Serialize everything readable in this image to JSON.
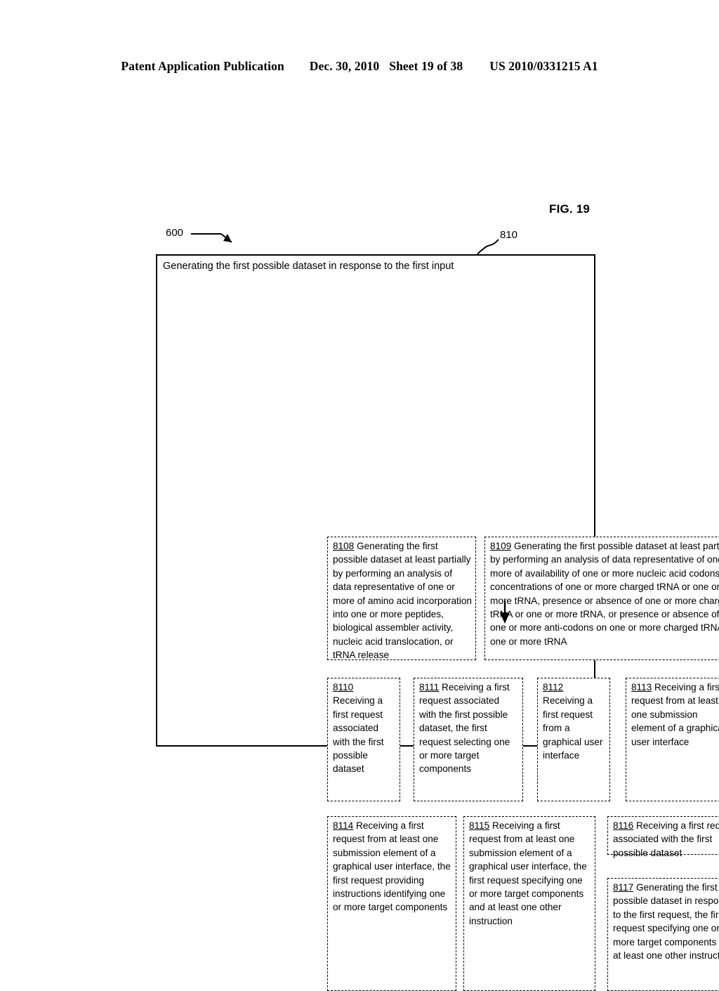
{
  "header": {
    "publication": "Patent Application Publication",
    "date": "Dec. 30, 2010",
    "sheet": "Sheet 19 of 38",
    "patent_number": "US 2010/0331215 A1"
  },
  "figure": {
    "label": "FIG. 19",
    "ref_outer": "600",
    "ref_frame": "810",
    "frame_title": "Generating the first possible dataset in response to the first input"
  },
  "boxes": {
    "b8108": {
      "number": "8108",
      "text": " Generating the first possible dataset at least partially by performing an analysis of data representative of one or more of amino acid incorporation into one or more peptides, biological assembler activity, nucleic acid translocation, or tRNA release"
    },
    "b8109": {
      "number": "8109",
      "text": " Generating the first possible dataset at least partially by performing an analysis of data representative of one or more of availability of one or more nucleic acid codons, concentrations of one or more charged tRNA or one or more tRNA, presence or absence of one or more charged tRNA or one or more tRNA, or presence or absence of one or more anti-codons on one or more charged tRNA or one or more tRNA"
    },
    "b8110": {
      "number": "8110",
      "text": " Receiving a first request associated with the first possible dataset"
    },
    "b8111": {
      "number": "8111",
      "text": " Receiving a first request associated with the first possible dataset, the first request selecting one or more target components"
    },
    "b8112": {
      "number": "8112",
      "text": " Receiving a first request from a graphical user interface"
    },
    "b8113": {
      "number": "8113",
      "text": " Receiving a first request from at least one submission element of a graphical user interface"
    },
    "b8114": {
      "number": "8114",
      "text": " Receiving a first request from at least one submission element of a graphical user interface, the first request providing instructions identifying one or more target components"
    },
    "b8115": {
      "number": "8115",
      "text": " Receiving a first request from at least one submission element of a graphical user interface, the first request specifying one or more target components and at least one other instruction"
    },
    "b8116": {
      "number": "8116",
      "text": " Receiving a first request associated with the first possible dataset"
    },
    "b8117": {
      "number": "8117",
      "text": " Generating the first possible dataset in response to the first request, the first request specifying one or more target components and at least one other instruction"
    }
  },
  "colors": {
    "ink": "#000000",
    "paper": "#ffffff"
  }
}
